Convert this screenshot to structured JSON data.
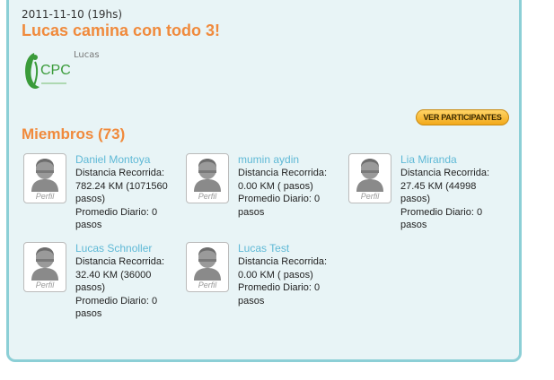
{
  "event": {
    "date": "2011-11-10 (19hs)",
    "title": "Lucas camina con todo 3!",
    "organizer": "Lucas",
    "logo_text": "CPC"
  },
  "participants_button": "VER PARTICIPANTES",
  "members_title": "Miembros (73)",
  "avatar_label": "Perfil",
  "members": [
    {
      "name": "Daniel Montoya",
      "distance_label": "Distancia Recorrida:",
      "distance": "782.24 KM (1071560 pasos)",
      "daily": "Promedio Diario: 0 pasos"
    },
    {
      "name": "mumin aydin",
      "distance_label": "Distancia Recorrida:",
      "distance": "0.00 KM ( pasos)",
      "daily": "Promedio Diario: 0 pasos"
    },
    {
      "name": "Lia Miranda",
      "distance_label": "Distancia Recorrida:",
      "distance": "27.45 KM (44998 pasos)",
      "daily": "Promedio Diario: 0 pasos"
    },
    {
      "name": "Lucas Schnoller",
      "distance_label": "Distancia Recorrida:",
      "distance": "32.40 KM (36000 pasos)",
      "daily": "Promedio Diario: 0 pasos"
    },
    {
      "name": "Lucas Test",
      "distance_label": "Distancia Recorrida:",
      "distance": "0.00 KM ( pasos)",
      "daily": "Promedio Diario: 0 pasos"
    }
  ],
  "colors": {
    "accent": "#f08a3c",
    "link": "#5fb9d6",
    "panel_border": "#8ccfd6"
  }
}
